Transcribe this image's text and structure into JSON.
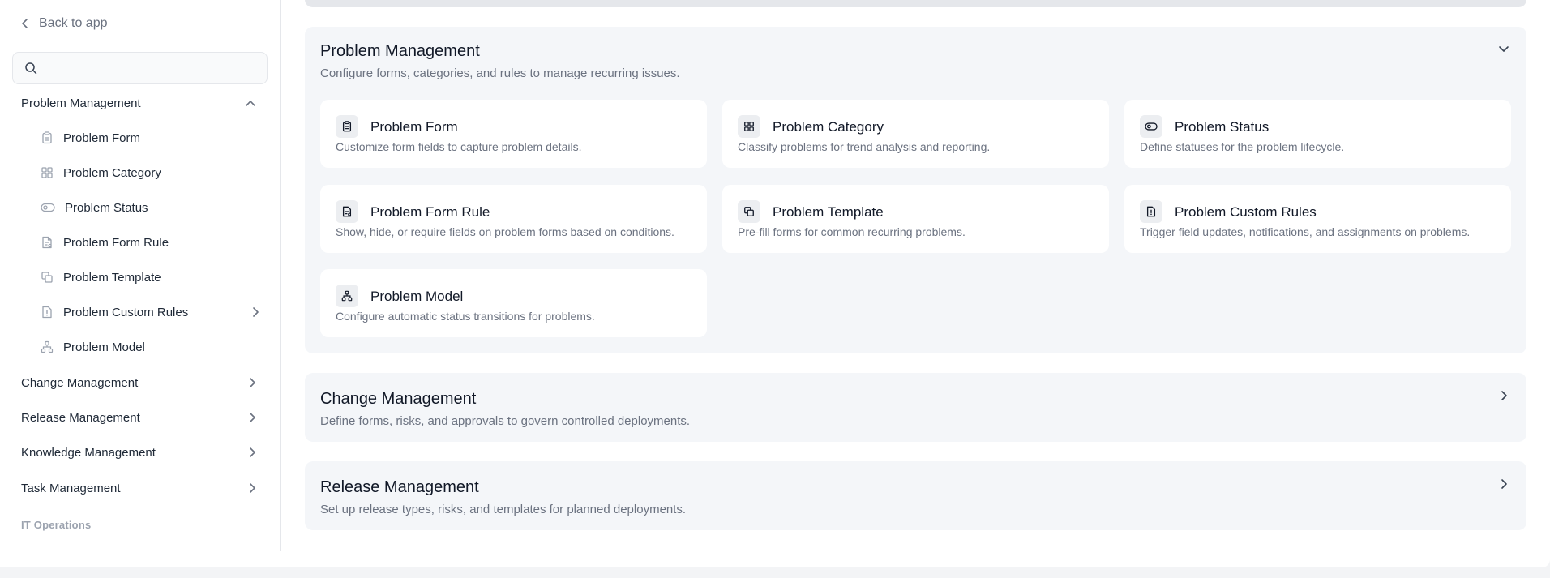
{
  "sidebar": {
    "back_label": "Back to app",
    "search": {
      "placeholder": "",
      "value": ""
    },
    "groups": {
      "problem": "Problem Management",
      "change": "Change Management",
      "release": "Release Management",
      "knowledge": "Knowledge Management",
      "task": "Task Management"
    },
    "items": [
      {
        "label": "Problem Form",
        "icon": "clipboard-icon"
      },
      {
        "label": "Problem Category",
        "icon": "grid-icon"
      },
      {
        "label": "Problem Status",
        "icon": "toggle-icon"
      },
      {
        "label": "Problem Form Rule",
        "icon": "document-rule-icon"
      },
      {
        "label": "Problem Template",
        "icon": "copy-icon"
      },
      {
        "label": "Problem Custom Rules",
        "icon": "file-alert-icon"
      },
      {
        "label": "Problem Model",
        "icon": "hierarchy-icon"
      }
    ],
    "section_label": "IT Operations"
  },
  "main": {
    "problem_section": {
      "title": "Problem Management",
      "description": "Configure forms, categories, and rules to manage recurring issues.",
      "expanded": true,
      "cards": [
        {
          "title": "Problem Form",
          "description": "Customize form fields to capture problem details.",
          "icon": "clipboard-icon"
        },
        {
          "title": "Problem Category",
          "description": "Classify problems for trend analysis and reporting.",
          "icon": "grid-icon"
        },
        {
          "title": "Problem Status",
          "description": "Define statuses for the problem lifecycle.",
          "icon": "toggle-icon"
        },
        {
          "title": "Problem Form Rule",
          "description": "Show, hide, or require fields on problem forms based on conditions.",
          "icon": "document-rule-icon"
        },
        {
          "title": "Problem Template",
          "description": "Pre-fill forms for common recurring problems.",
          "icon": "copy-icon"
        },
        {
          "title": "Problem Custom Rules",
          "description": "Trigger field updates, notifications, and assignments on problems.",
          "icon": "file-alert-icon"
        },
        {
          "title": "Problem Model",
          "description": "Configure automatic status transitions for problems.",
          "icon": "hierarchy-icon"
        }
      ]
    },
    "change_section": {
      "title": "Change Management",
      "description": "Define forms, risks, and approvals to govern controlled deployments.",
      "expanded": false
    },
    "release_section": {
      "title": "Release Management",
      "description": "Set up release types, risks, and templates for planned deployments.",
      "expanded": false
    }
  },
  "colors": {
    "section_bg": "#f4f6f9",
    "card_bg": "#ffffff",
    "muted_text": "#6b7280",
    "primary_text": "#111827"
  }
}
